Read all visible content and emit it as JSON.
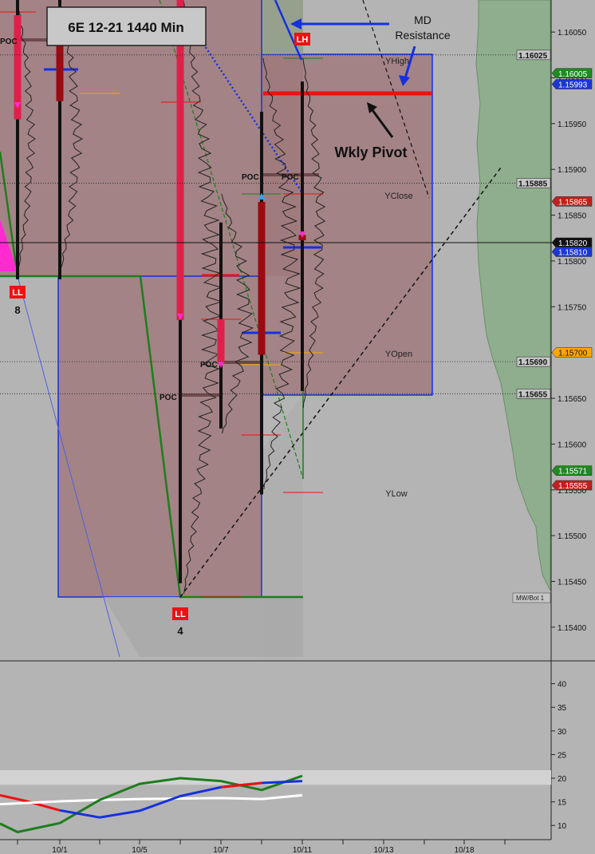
{
  "title": "6E 12-21 1440 Min",
  "colors": {
    "background": "#b4b4b4",
    "box_fill": "#a07a7c",
    "green_zone": "#8fae8e",
    "pink_bar": "#e0204a",
    "dark_red_bar": "#9a0b12",
    "blue": "#1530e0",
    "green_line": "#1e7d1e",
    "magenta": "#ff2ad0",
    "white": "#ffffff",
    "red": "#ee1111",
    "orange": "#ffa500",
    "light_green_tag": "#1f8a1f",
    "red_tag": "#c02020",
    "blue_tag": "#1b36d8"
  },
  "annotations": {
    "md_resistance": "MD\nResistance",
    "wkly_pivot": "Wkly Pivot",
    "yhigh": "YHigh",
    "yclose": "YClose",
    "yopen": "YOpen",
    "ylow": "YLow",
    "poc": "POC",
    "lh": "LH",
    "ll": "LL",
    "ll8_count": "8",
    "ll4_count": "4",
    "mw_bot": "MW/Bot 1"
  },
  "chart_data": [
    {
      "type": "bar",
      "title": "6E 12-21 1440 Min",
      "price_axis": {
        "ticks": [
          "1.16050",
          "1.16000",
          "1.15950",
          "1.15900",
          "1.15850",
          "1.15800",
          "1.15750",
          "1.15700",
          "1.15650",
          "1.15600",
          "1.15550",
          "1.15500",
          "1.15450",
          "1.15400"
        ],
        "ylim": [
          1.15365,
          1.16085
        ]
      },
      "x_axis": {
        "ticks": [
          "10/1",
          "10/5",
          "10/7",
          "10/11",
          "10/13",
          "10/18"
        ]
      },
      "bars": [
        {
          "open": 1.16068,
          "high": 1.16085,
          "low": 1.1578,
          "close": 1.15955,
          "color": "pink"
        },
        {
          "open": 1.16065,
          "high": 1.16085,
          "low": 1.1578,
          "close": 1.15975,
          "color": "dark"
        },
        {
          "open": 1.16085,
          "high": 1.16085,
          "low": 1.15448,
          "close": 1.15736,
          "color": "pink"
        },
        {
          "open": 1.15736,
          "high": 1.15842,
          "low": 1.15617,
          "close": 1.15688,
          "color": "pink"
        },
        {
          "open": 1.15698,
          "high": 1.15963,
          "low": 1.15545,
          "close": 1.15864,
          "color": "dark"
        },
        {
          "open": 1.15828,
          "high": 1.15996,
          "low": 1.15658,
          "close": 1.15823,
          "color": "dark"
        }
      ],
      "price_tags": [
        {
          "label": "1.16025",
          "style": "dotted"
        },
        {
          "label": "1.16005",
          "style": "green"
        },
        {
          "label": "1.15993",
          "style": "blue"
        },
        {
          "label": "1.15885",
          "style": "dotted"
        },
        {
          "label": "1.15865",
          "style": "red"
        },
        {
          "label": "1.15820",
          "style": "black"
        },
        {
          "label": "1.15810",
          "style": "blue"
        },
        {
          "label": "1.15700",
          "style": "orange"
        },
        {
          "label": "1.15690",
          "style": "dotted"
        },
        {
          "label": "1.15655",
          "style": "dotted"
        },
        {
          "label": "1.15571",
          "style": "green"
        },
        {
          "label": "1.15555",
          "style": "red"
        }
      ]
    },
    {
      "type": "line",
      "y_axis": {
        "ticks": [
          "40",
          "35",
          "30",
          "25",
          "20",
          "15",
          "10"
        ],
        "ylim": [
          7,
          44.5
        ]
      },
      "series": [
        {
          "color": "#ee1111",
          "x": [
            0,
            32,
            75
          ],
          "values": [
            16.4,
            15.2,
            13.2
          ]
        },
        {
          "color": "#ffffff",
          "x": [
            0,
            75,
            125,
            175,
            226,
            277,
            328,
            379
          ],
          "values": [
            14.5,
            15.1,
            15.4,
            15.6,
            15.7,
            15.8,
            15.6,
            16.4
          ]
        },
        {
          "color": "#1e7d1e",
          "x": [
            0,
            22,
            75,
            125,
            175,
            226,
            277,
            328,
            379
          ],
          "values": [
            10.4,
            8.6,
            10.5,
            15.4,
            18.8,
            20.0,
            19.4,
            17.5,
            20.5
          ]
        },
        {
          "color": "#1530e0",
          "x": [
            75,
            125,
            175,
            226,
            277,
            328,
            379
          ],
          "values": [
            13.2,
            11.7,
            13.1,
            16.2,
            18.1,
            19.0,
            19.4
          ]
        },
        {
          "color": "#ee1111",
          "x": [
            277,
            328
          ],
          "values": [
            18.1,
            19.0
          ]
        }
      ]
    }
  ]
}
